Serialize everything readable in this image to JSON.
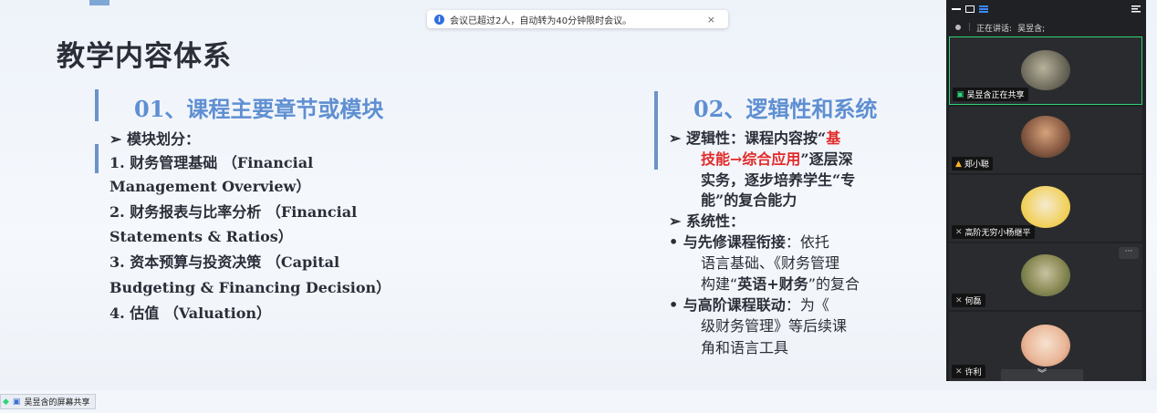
{
  "notification": {
    "text": "会议已超过2人，自动转为40分钟限时会议。",
    "close": "×"
  },
  "slide": {
    "title": "教学内容体系",
    "col1": {
      "heading": "01、课程主要章节或模块",
      "lines": [
        "➢  模块划分：",
        "1.     财务管理基础 （Financial",
        "         Management Overview）",
        "2.     财务报表与比率分析 （Financial",
        "         Statements & Ratios）",
        "3.     资本预算与投资决策 （Capital",
        "         Budgeting & Financing Decision）",
        "4.     估值 （Valuation）"
      ]
    },
    "col2": {
      "heading": "02、逻辑性和系统",
      "l1a": "➢  逻辑性：课程内容按“",
      "l1b": "基",
      "l2a": "技能→综合应用",
      "l2b": "”逐层深",
      "l3": "实务，逐步培养学生“专",
      "l4": "能”的复合能力",
      "l5": "➢  系统性：",
      "l6a": "•    与先修课程衔接",
      "l6b": "：依托",
      "l7": "语言基础、《财务管理",
      "l8a": "构建“",
      "l8b": "英语+财务",
      "l8c": "”的复合",
      "l9a": "•    与高阶课程联动",
      "l9b": "：为《",
      "l10": "级财务管理》等后续课",
      "l11": "角和语言工具"
    }
  },
  "panel": {
    "speaking_label": "正在讲话:",
    "speaking_name": "吴昱含;",
    "participants": [
      {
        "name": "吴昱含正在共享"
      },
      {
        "name": "郑小聪"
      },
      {
        "name": "高阶无穷小杨继平"
      },
      {
        "name": "何磊"
      },
      {
        "name": "许利"
      }
    ],
    "more": "···",
    "collapse": "︾"
  },
  "share_label": "吴昱含的屏幕共享"
}
